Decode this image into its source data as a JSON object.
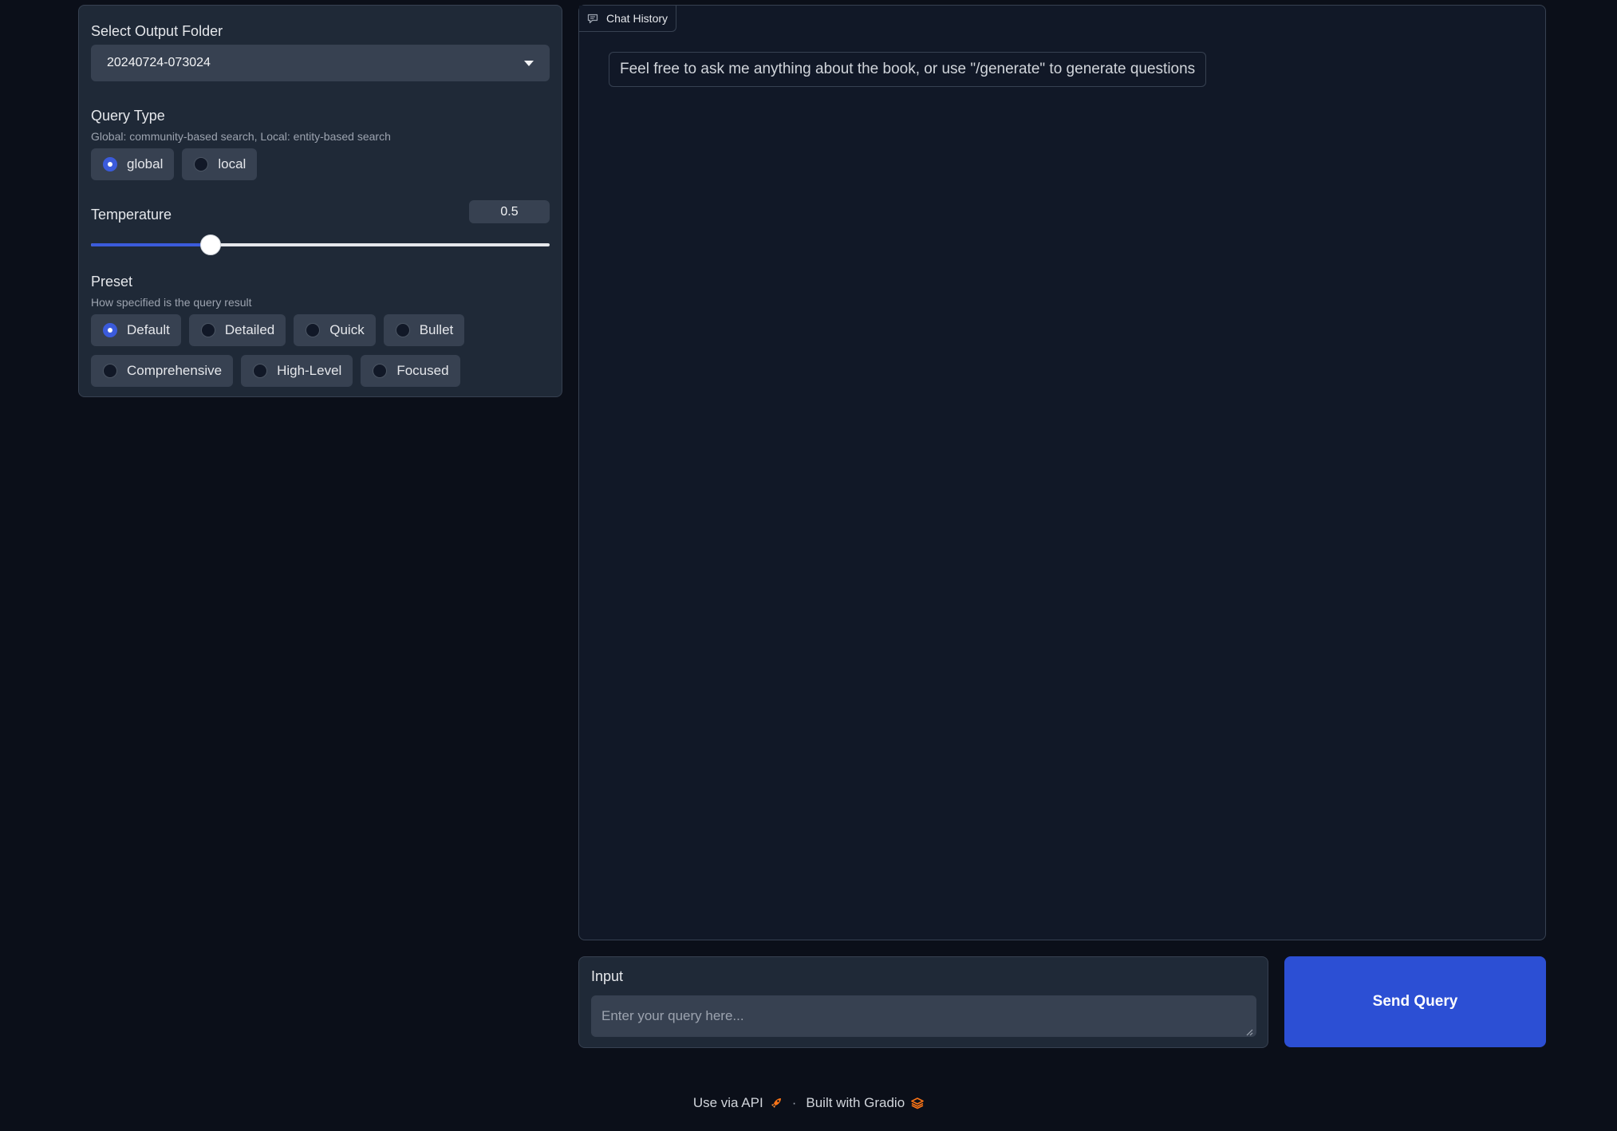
{
  "settings": {
    "output_folder": {
      "label": "Select Output Folder",
      "value": "20240724-073024"
    },
    "query_type": {
      "label": "Query Type",
      "info": "Global: community-based search, Local: entity-based search",
      "options": [
        "global",
        "local"
      ],
      "selected": "global"
    },
    "temperature": {
      "label": "Temperature",
      "value": "0.5",
      "min": 0,
      "max": 2,
      "fraction": 0.26
    },
    "preset": {
      "label": "Preset",
      "info": "How specified is the query result",
      "row1": [
        "Default",
        "Detailed",
        "Quick",
        "Bullet"
      ],
      "row2": [
        "Comprehensive",
        "High-Level",
        "Focused"
      ],
      "selected": "Default"
    }
  },
  "chat": {
    "label": "Chat History",
    "messages": [
      "Feel free to ask me anything about the book, or use \"/generate\" to generate questions"
    ]
  },
  "input": {
    "label": "Input",
    "placeholder": "Enter your query here...",
    "value": ""
  },
  "send_button": {
    "label": "Send Query"
  },
  "footer": {
    "api_label": "Use via API",
    "separator": "·",
    "built_label": "Built with Gradio"
  },
  "colors": {
    "background": "#0b0f19",
    "panel": "#1f2937",
    "accent": "#2c4fd4",
    "footer_icon": "#f97316"
  }
}
